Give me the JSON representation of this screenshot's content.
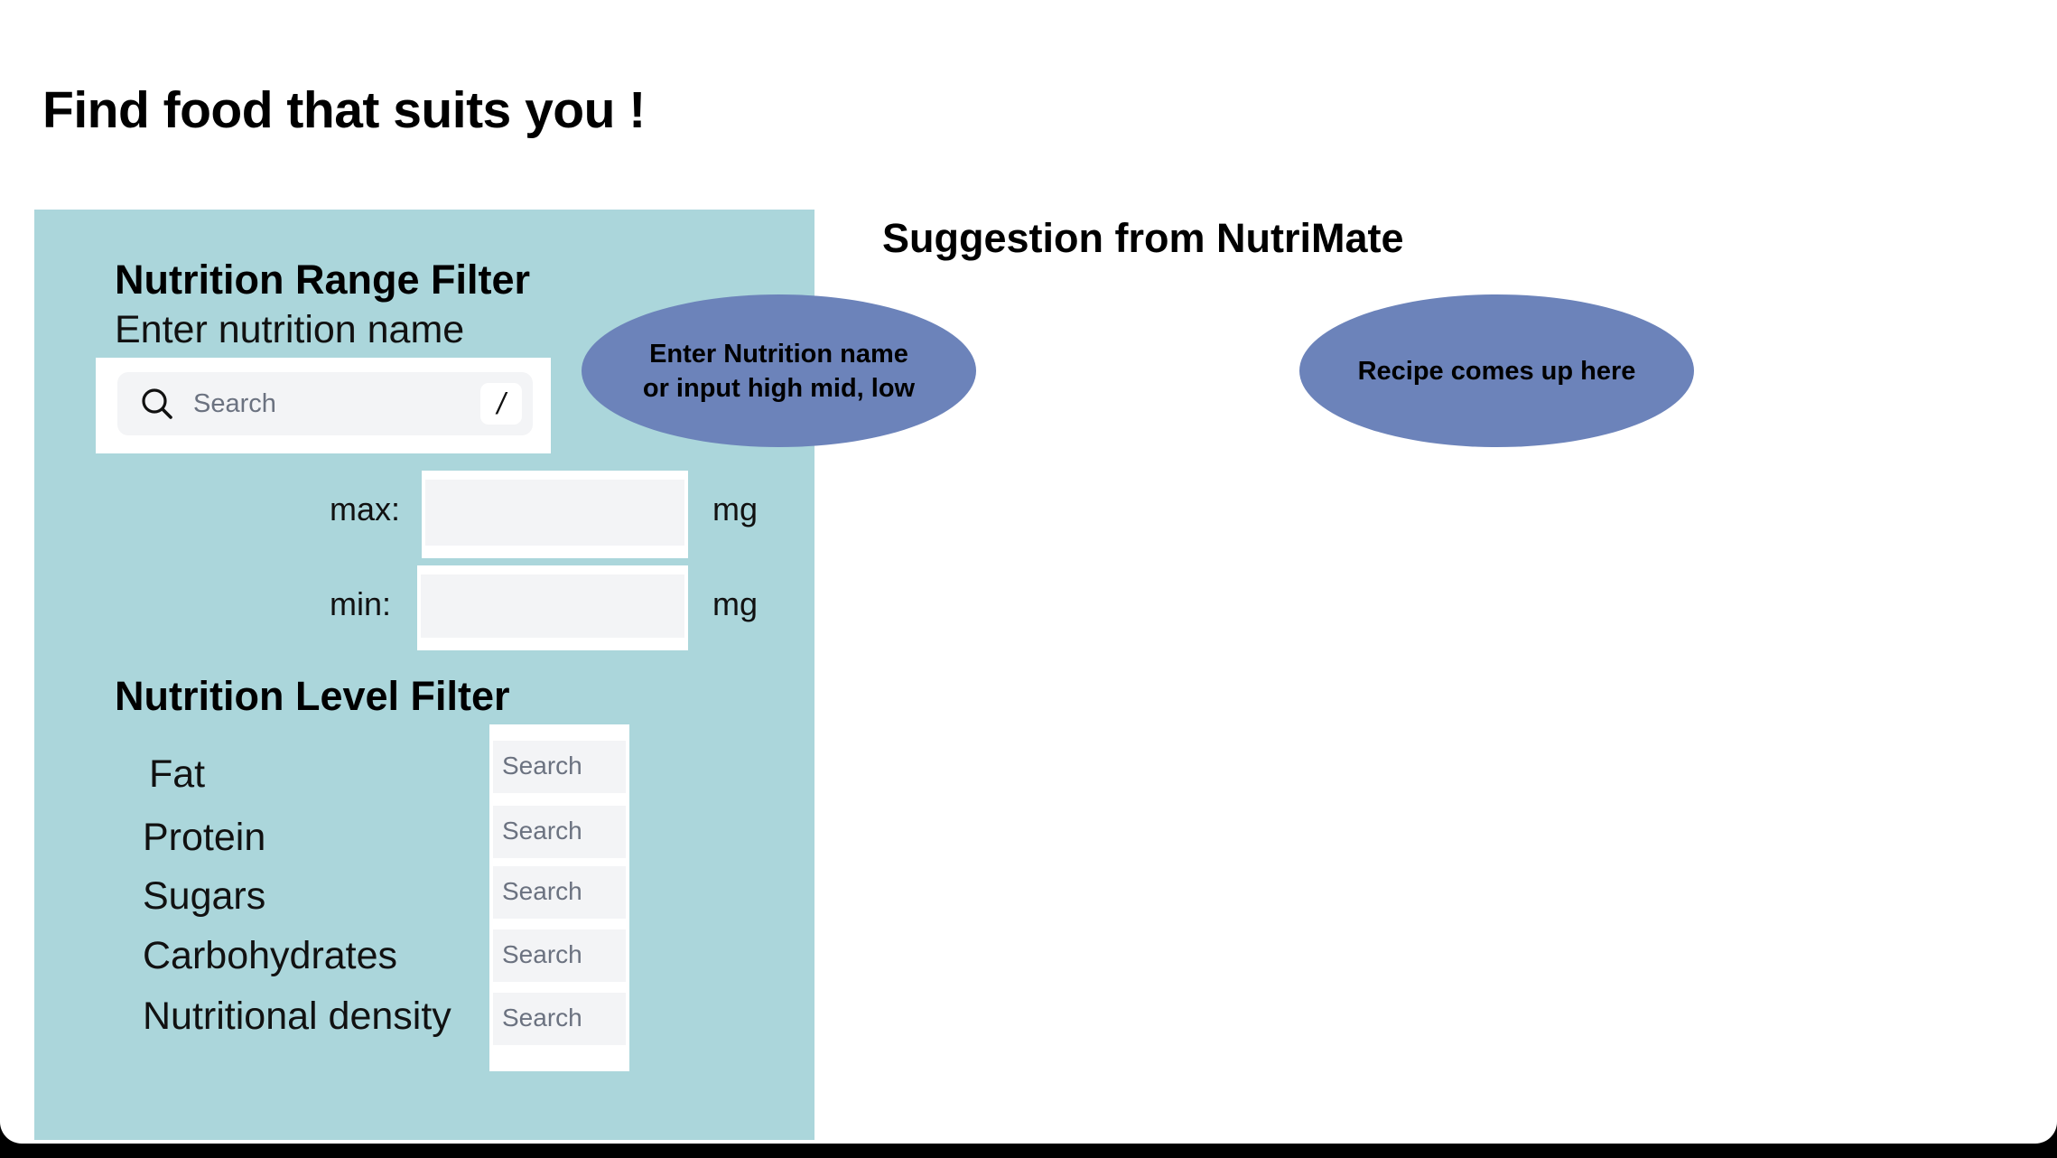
{
  "page": {
    "title": "Find food that suits you !"
  },
  "range_filter": {
    "heading": "Nutrition Range Filter",
    "prompt": "Enter nutrition name",
    "search": {
      "placeholder": "Search",
      "shortcut": "/"
    },
    "max_label": "max:",
    "min_label": "min:",
    "max_unit": "mg",
    "min_unit": "mg",
    "max_value": "",
    "min_value": ""
  },
  "level_filter": {
    "heading": "Nutrition Level Filter",
    "items": [
      {
        "label": "Fat",
        "placeholder": "Search"
      },
      {
        "label": "Protein",
        "placeholder": "Search"
      },
      {
        "label": "Sugars",
        "placeholder": "Search"
      },
      {
        "label": "Carbohydrates",
        "placeholder": "Search"
      },
      {
        "label": "Nutritional density",
        "placeholder": "Search"
      }
    ]
  },
  "annotations": {
    "input_hint_line1": "Enter Nutrition name",
    "input_hint_line2": "or input high mid, low",
    "result_hint": "Recipe comes up here"
  },
  "suggestion": {
    "heading": "Suggestion from NutriMate"
  },
  "colors": {
    "panel": "#abd6db",
    "bubble": "#6c83ba",
    "input_fill": "#f3f4f6",
    "placeholder_text": "#6b7280"
  },
  "icons": [
    "search-icon"
  ]
}
